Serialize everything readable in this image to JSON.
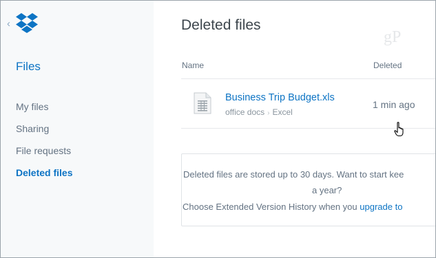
{
  "sidebar": {
    "section_title": "Files",
    "items": [
      {
        "label": "My files",
        "active": false
      },
      {
        "label": "Sharing",
        "active": false
      },
      {
        "label": "File requests",
        "active": false
      },
      {
        "label": "Deleted files",
        "active": true
      }
    ]
  },
  "main": {
    "title": "Deleted files",
    "watermark": "gP",
    "columns": {
      "name": "Name",
      "deleted": "Deleted"
    },
    "rows": [
      {
        "file_name": "Business Trip Budget.xls",
        "path": [
          "office docs",
          "Excel"
        ],
        "deleted": "1 min ago"
      }
    ],
    "info": {
      "line1": "Deleted files are stored up to 30 days. Want to start kee",
      "line2": "a year?",
      "line3_prefix": "Choose Extended Version History when you ",
      "line3_link": "upgrade to"
    }
  },
  "colors": {
    "accent": "#0d74c4",
    "sidebar_bg": "#f7f9fa",
    "text_muted": "#637282"
  },
  "icons": [
    "dropbox-logo",
    "back-chevron-icon",
    "spreadsheet-file-icon",
    "path-chevron-icon",
    "hand-pointer-cursor"
  ]
}
